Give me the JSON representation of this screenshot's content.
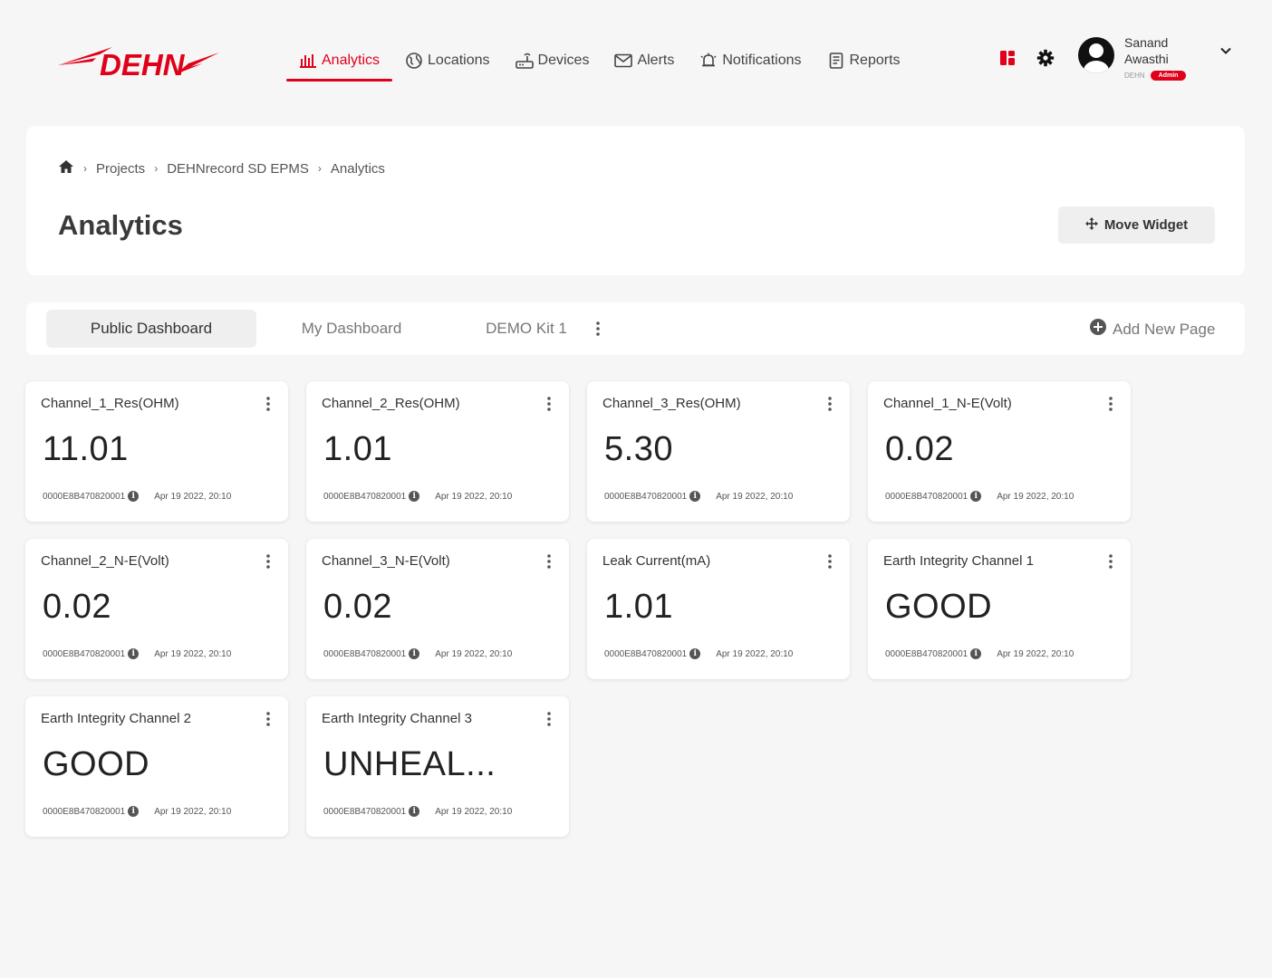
{
  "brand": {
    "logo_text": "DEHN",
    "accent": "#e1001a"
  },
  "nav": {
    "items": [
      {
        "label": "Analytics",
        "icon": "bar-chart-icon",
        "active": true
      },
      {
        "label": "Locations",
        "icon": "globe-icon",
        "active": false
      },
      {
        "label": "Devices",
        "icon": "router-icon",
        "active": false
      },
      {
        "label": "Alerts",
        "icon": "mail-icon",
        "active": false
      },
      {
        "label": "Notifications",
        "icon": "alarm-bell-icon",
        "active": false
      },
      {
        "label": "Reports",
        "icon": "document-icon",
        "active": false
      }
    ]
  },
  "user": {
    "name": "Sanand Awasthi",
    "org": "DEHN",
    "role": "Admin"
  },
  "breadcrumb": {
    "home_icon": "home-icon",
    "items": [
      "Projects",
      "DEHNrecord SD EPMS",
      "Analytics"
    ]
  },
  "page": {
    "title": "Analytics",
    "move_widget_label": "Move Widget"
  },
  "tabs": {
    "items": [
      "Public Dashboard",
      "My Dashboard",
      "DEMO Kit 1"
    ],
    "active": "Public Dashboard",
    "add_page_label": "Add New Page"
  },
  "widgets": [
    {
      "title": "Channel_1_Res(OHM)",
      "value": "11.01",
      "device": "0000E8B470820001",
      "time": "Apr 19 2022, 20:10"
    },
    {
      "title": "Channel_2_Res(OHM)",
      "value": "1.01",
      "device": "0000E8B470820001",
      "time": "Apr 19 2022, 20:10"
    },
    {
      "title": "Channel_3_Res(OHM)",
      "value": "5.30",
      "device": "0000E8B470820001",
      "time": "Apr 19 2022, 20:10"
    },
    {
      "title": "Channel_1_N-E(Volt)",
      "value": "0.02",
      "device": "0000E8B470820001",
      "time": "Apr 19 2022, 20:10"
    },
    {
      "title": "Channel_2_N-E(Volt)",
      "value": "0.02",
      "device": "0000E8B470820001",
      "time": "Apr 19 2022, 20:10"
    },
    {
      "title": "Channel_3_N-E(Volt)",
      "value": "0.02",
      "device": "0000E8B470820001",
      "time": "Apr 19 2022, 20:10"
    },
    {
      "title": "Leak Current(mA)",
      "value": "1.01",
      "device": "0000E8B470820001",
      "time": "Apr 19 2022, 20:10"
    },
    {
      "title": "Earth Integrity Channel 1",
      "value": "GOOD",
      "device": "0000E8B470820001",
      "time": "Apr 19 2022, 20:10"
    },
    {
      "title": "Earth Integrity Channel 2",
      "value": "GOOD",
      "device": "0000E8B470820001",
      "time": "Apr 19 2022, 20:10"
    },
    {
      "title": "Earth Integrity Channel 3",
      "value": "UNHEAL...",
      "device": "0000E8B470820001",
      "time": "Apr 19 2022, 20:10"
    }
  ]
}
